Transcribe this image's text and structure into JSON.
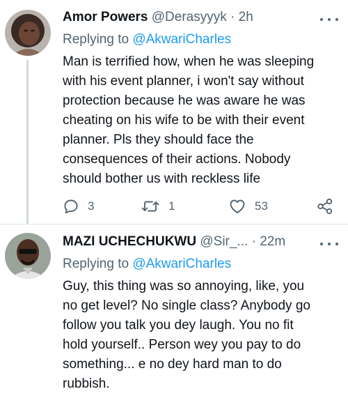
{
  "tweets": [
    {
      "name": "Amor Powers",
      "handle": "@Derasyyyk",
      "dot": "·",
      "time": "2h",
      "replying_prefix": "Replying to",
      "replying_to": "@AkwariCharles",
      "body_lines": [
        "Man is terrified how, when he was sleeping",
        "with his event planner, i won't say without",
        "protection because he was aware he was",
        "cheating on his wife to be with their event",
        "planner. Pls they should face the",
        "consequences of their actions. Nobody",
        "should bother us with reckless life"
      ],
      "replies": "3",
      "retweets": "1",
      "likes": "53"
    },
    {
      "name": "MAZI UCHECHUKWU",
      "handle": "@Sir_...",
      "dot": "·",
      "time": "22m",
      "replying_prefix": "Replying to",
      "replying_to": "@AkwariCharles",
      "body_lines": [
        "Guy, this thing was so annoying, like, you",
        "no get level? No single class? Anybody go",
        "follow you talk you dey laugh. You no fit",
        "hold yourself.. Person wey you pay to do",
        "something... e no dey hard man to do",
        "rubbish."
      ]
    }
  ],
  "colors": {
    "accent": "#1d9bf0",
    "secondary_text": "#536471",
    "primary_text": "#0f1419"
  },
  "icons": {
    "reply": "reply-icon",
    "retweet": "retweet-icon",
    "like": "heart-icon",
    "share": "share-icon",
    "more": "more-options-icon"
  }
}
